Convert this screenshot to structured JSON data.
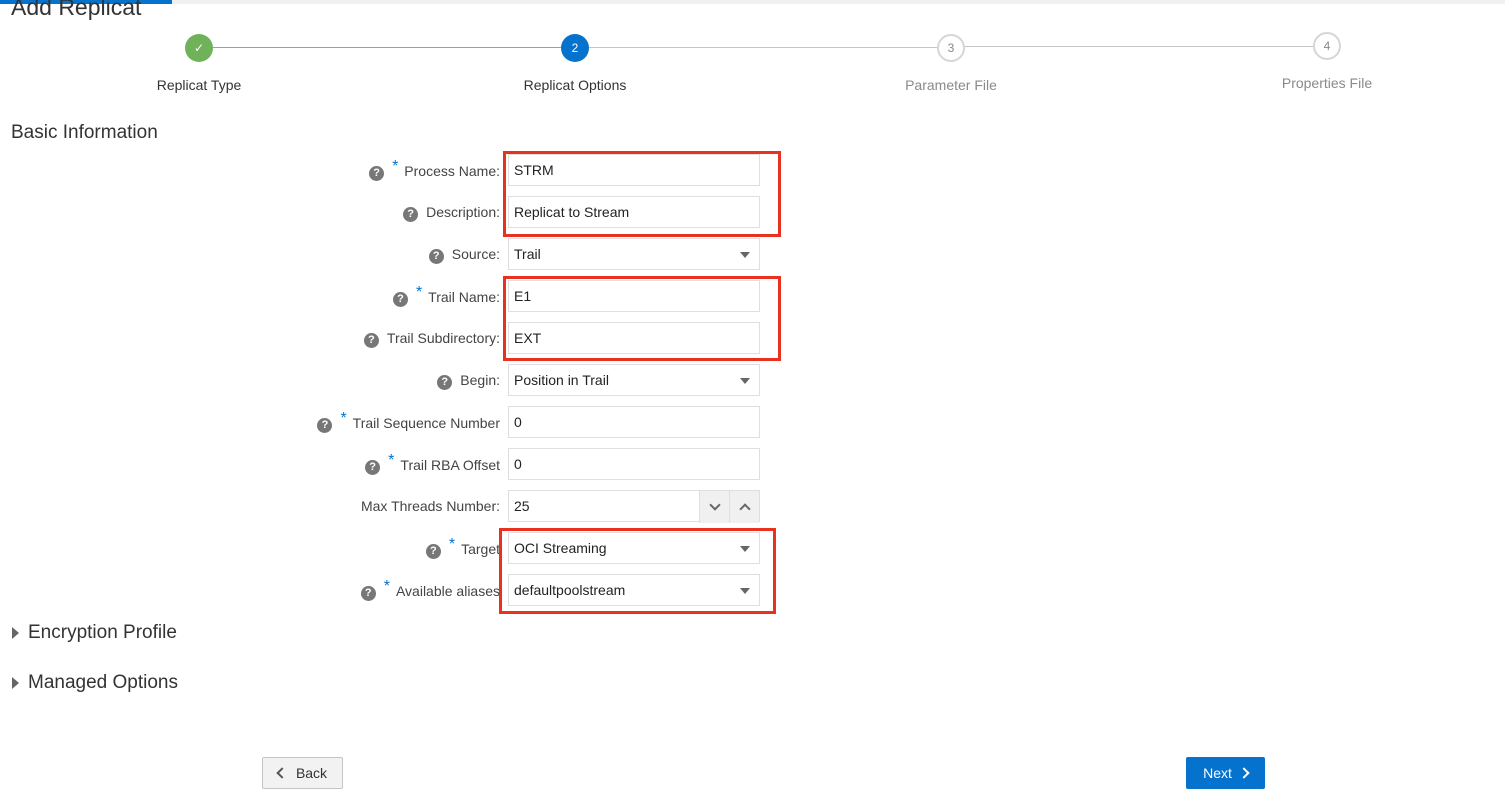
{
  "page": {
    "title": "Add Replicat"
  },
  "wizard": {
    "steps": [
      {
        "number": "✓",
        "label": "Replicat Type",
        "state": "done"
      },
      {
        "number": "2",
        "label": "Replicat Options",
        "state": "current"
      },
      {
        "number": "3",
        "label": "Parameter File",
        "state": "future"
      },
      {
        "number": "4",
        "label": "Properties File",
        "state": "future"
      }
    ]
  },
  "basic_info": {
    "heading": "Basic Information",
    "process_name": {
      "label": "Process Name:",
      "value": "STRM",
      "required": true
    },
    "description": {
      "label": "Description:",
      "value": "Replicat to Stream"
    },
    "source": {
      "label": "Source:",
      "value": "Trail"
    },
    "trail_name": {
      "label": "Trail Name:",
      "value": "E1",
      "required": true
    },
    "trail_subdirectory": {
      "label": "Trail Subdirectory:",
      "value": "EXT"
    },
    "begin": {
      "label": "Begin:",
      "value": "Position in Trail"
    },
    "trail_sequence_number": {
      "label": "Trail Sequence Number",
      "value": "0",
      "required": true
    },
    "trail_rba_offset": {
      "label": "Trail RBA Offset",
      "value": "0",
      "required": true
    },
    "max_threads": {
      "label": "Max Threads Number:",
      "value": "25"
    },
    "target": {
      "label": "Target",
      "value": "OCI Streaming",
      "required": true
    },
    "available_aliases": {
      "label": "Available aliases",
      "value": "defaultpoolstream",
      "required": true
    }
  },
  "sections": {
    "encryption_profile": "Encryption Profile",
    "managed_options": "Managed Options"
  },
  "buttons": {
    "back": "Back",
    "next": "Next"
  },
  "colors": {
    "accent": "#0572ce",
    "success": "#70b25a",
    "highlight": "#e8321f"
  }
}
